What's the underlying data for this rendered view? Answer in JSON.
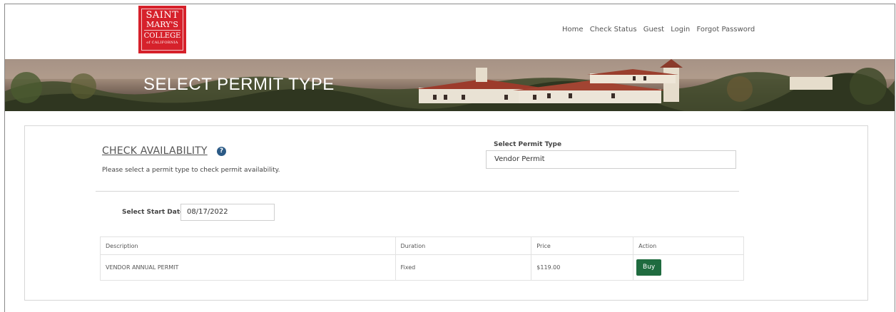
{
  "logo": {
    "line1": "SAINT",
    "line2": "MARY'S",
    "line3": "COLLEGE",
    "line4": "of CALIFORNIA",
    "color": "#d6212b"
  },
  "nav": {
    "items": [
      "Home",
      "Check Status",
      "Guest",
      "Login",
      "Forgot Password"
    ]
  },
  "banner": {
    "title": "SELECT PERMIT TYPE"
  },
  "availability": {
    "title": "CHECK AVAILABILITY",
    "help_icon": "question-circle-icon",
    "description": "Please select a permit type to check permit availability."
  },
  "permit_type": {
    "label": "Select Permit Type",
    "selected": "Vendor Permit"
  },
  "start_date": {
    "label": "Select Start Date:",
    "value": "08/17/2022"
  },
  "table": {
    "headers": [
      "Description",
      "Duration",
      "Price",
      "Action"
    ],
    "rows": [
      {
        "description": "VENDOR ANNUAL PERMIT",
        "duration": "Fixed",
        "price": "$119.00",
        "action": "Buy"
      }
    ]
  },
  "colors": {
    "accent": "#1f6b3f",
    "help": "#2b5a86"
  }
}
